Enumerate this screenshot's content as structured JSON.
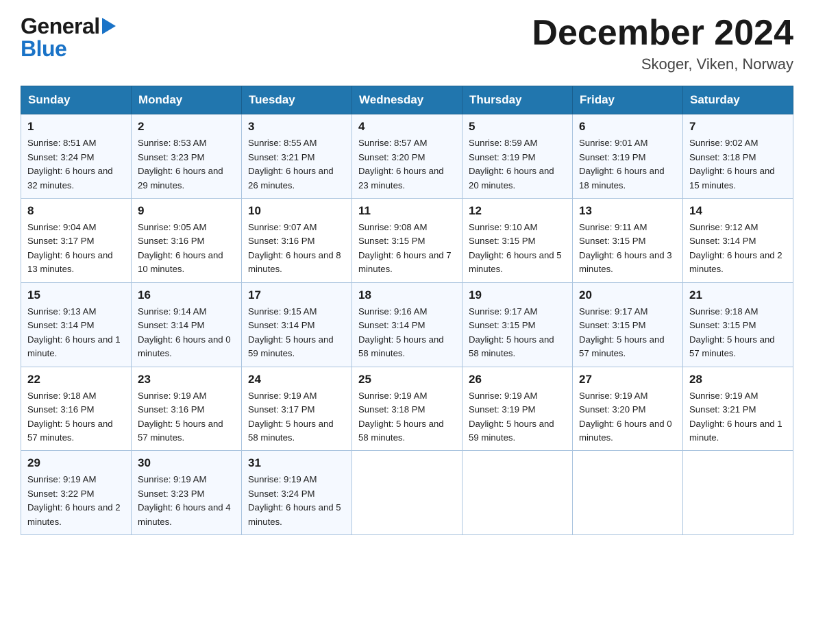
{
  "header": {
    "logo_general": "General",
    "logo_blue": "Blue",
    "title": "December 2024",
    "subtitle": "Skoger, Viken, Norway"
  },
  "days_of_week": [
    "Sunday",
    "Monday",
    "Tuesday",
    "Wednesday",
    "Thursday",
    "Friday",
    "Saturday"
  ],
  "weeks": [
    [
      {
        "num": "1",
        "sunrise": "8:51 AM",
        "sunset": "3:24 PM",
        "daylight": "6 hours and 32 minutes."
      },
      {
        "num": "2",
        "sunrise": "8:53 AM",
        "sunset": "3:23 PM",
        "daylight": "6 hours and 29 minutes."
      },
      {
        "num": "3",
        "sunrise": "8:55 AM",
        "sunset": "3:21 PM",
        "daylight": "6 hours and 26 minutes."
      },
      {
        "num": "4",
        "sunrise": "8:57 AM",
        "sunset": "3:20 PM",
        "daylight": "6 hours and 23 minutes."
      },
      {
        "num": "5",
        "sunrise": "8:59 AM",
        "sunset": "3:19 PM",
        "daylight": "6 hours and 20 minutes."
      },
      {
        "num": "6",
        "sunrise": "9:01 AM",
        "sunset": "3:19 PM",
        "daylight": "6 hours and 18 minutes."
      },
      {
        "num": "7",
        "sunrise": "9:02 AM",
        "sunset": "3:18 PM",
        "daylight": "6 hours and 15 minutes."
      }
    ],
    [
      {
        "num": "8",
        "sunrise": "9:04 AM",
        "sunset": "3:17 PM",
        "daylight": "6 hours and 13 minutes."
      },
      {
        "num": "9",
        "sunrise": "9:05 AM",
        "sunset": "3:16 PM",
        "daylight": "6 hours and 10 minutes."
      },
      {
        "num": "10",
        "sunrise": "9:07 AM",
        "sunset": "3:16 PM",
        "daylight": "6 hours and 8 minutes."
      },
      {
        "num": "11",
        "sunrise": "9:08 AM",
        "sunset": "3:15 PM",
        "daylight": "6 hours and 7 minutes."
      },
      {
        "num": "12",
        "sunrise": "9:10 AM",
        "sunset": "3:15 PM",
        "daylight": "6 hours and 5 minutes."
      },
      {
        "num": "13",
        "sunrise": "9:11 AM",
        "sunset": "3:15 PM",
        "daylight": "6 hours and 3 minutes."
      },
      {
        "num": "14",
        "sunrise": "9:12 AM",
        "sunset": "3:14 PM",
        "daylight": "6 hours and 2 minutes."
      }
    ],
    [
      {
        "num": "15",
        "sunrise": "9:13 AM",
        "sunset": "3:14 PM",
        "daylight": "6 hours and 1 minute."
      },
      {
        "num": "16",
        "sunrise": "9:14 AM",
        "sunset": "3:14 PM",
        "daylight": "6 hours and 0 minutes."
      },
      {
        "num": "17",
        "sunrise": "9:15 AM",
        "sunset": "3:14 PM",
        "daylight": "5 hours and 59 minutes."
      },
      {
        "num": "18",
        "sunrise": "9:16 AM",
        "sunset": "3:14 PM",
        "daylight": "5 hours and 58 minutes."
      },
      {
        "num": "19",
        "sunrise": "9:17 AM",
        "sunset": "3:15 PM",
        "daylight": "5 hours and 58 minutes."
      },
      {
        "num": "20",
        "sunrise": "9:17 AM",
        "sunset": "3:15 PM",
        "daylight": "5 hours and 57 minutes."
      },
      {
        "num": "21",
        "sunrise": "9:18 AM",
        "sunset": "3:15 PM",
        "daylight": "5 hours and 57 minutes."
      }
    ],
    [
      {
        "num": "22",
        "sunrise": "9:18 AM",
        "sunset": "3:16 PM",
        "daylight": "5 hours and 57 minutes."
      },
      {
        "num": "23",
        "sunrise": "9:19 AM",
        "sunset": "3:16 PM",
        "daylight": "5 hours and 57 minutes."
      },
      {
        "num": "24",
        "sunrise": "9:19 AM",
        "sunset": "3:17 PM",
        "daylight": "5 hours and 58 minutes."
      },
      {
        "num": "25",
        "sunrise": "9:19 AM",
        "sunset": "3:18 PM",
        "daylight": "5 hours and 58 minutes."
      },
      {
        "num": "26",
        "sunrise": "9:19 AM",
        "sunset": "3:19 PM",
        "daylight": "5 hours and 59 minutes."
      },
      {
        "num": "27",
        "sunrise": "9:19 AM",
        "sunset": "3:20 PM",
        "daylight": "6 hours and 0 minutes."
      },
      {
        "num": "28",
        "sunrise": "9:19 AM",
        "sunset": "3:21 PM",
        "daylight": "6 hours and 1 minute."
      }
    ],
    [
      {
        "num": "29",
        "sunrise": "9:19 AM",
        "sunset": "3:22 PM",
        "daylight": "6 hours and 2 minutes."
      },
      {
        "num": "30",
        "sunrise": "9:19 AM",
        "sunset": "3:23 PM",
        "daylight": "6 hours and 4 minutes."
      },
      {
        "num": "31",
        "sunrise": "9:19 AM",
        "sunset": "3:24 PM",
        "daylight": "6 hours and 5 minutes."
      },
      null,
      null,
      null,
      null
    ]
  ]
}
